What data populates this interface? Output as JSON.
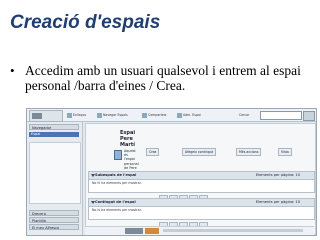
{
  "slide": {
    "title": "Creació d'espais",
    "bullet": "Accedim amb un usuari qualsevol i entrem al espai personal /barra d'eines / Crea."
  },
  "screenshot": {
    "toolbar": {
      "items": [
        "Enllaços",
        "Navegar Espais",
        "Comparteix",
        "Adm. Espai"
      ],
      "search_label": "Cercar"
    },
    "sidebar": {
      "navigator_label": "Navegador",
      "selected_item": "Espai",
      "bottom_panels": [
        "Drecera",
        "Plantilla",
        "El meu Alfresco"
      ]
    },
    "space": {
      "name_lines": [
        "Espai",
        "Pere",
        "Martí"
      ],
      "description_lines": [
        "Aquest",
        "és",
        "l'espai",
        "personal",
        "de Pere"
      ],
      "actions": [
        "Crea",
        "Afegeix contingut",
        "Més accions",
        "Vista"
      ]
    },
    "sections": [
      {
        "header": "Subespais de l'espai",
        "per_page": "Elements per pàgina: 10",
        "message": "No hi ha elements per mostrar."
      },
      {
        "header": "Contingut de l'espai",
        "per_page": "Elements per pàgina: 10",
        "message": "No hi ha elements per mostrar."
      }
    ],
    "footer": {
      "brand": "Alfresco"
    }
  }
}
